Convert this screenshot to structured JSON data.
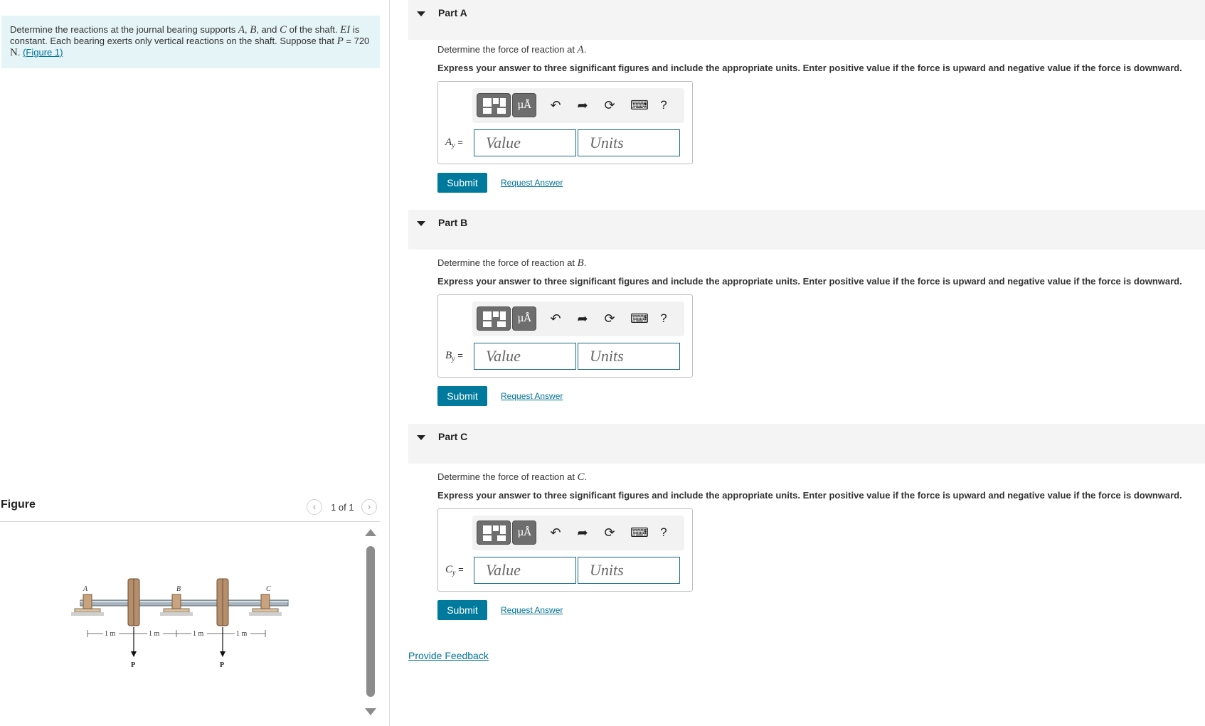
{
  "problem": {
    "text_1": "Determine the reactions at the journal bearing supports ",
    "var_a": "A",
    "text_2": ", ",
    "var_b": "B",
    "text_3": ", and ",
    "var_c": "C",
    "text_4": " of the shaft. ",
    "var_ei": "EI",
    "text_5": " is constant. Each bearing exerts only vertical reactions on the shaft. Suppose that ",
    "var_p": "P",
    "text_6": " = 720 ",
    "unit_n": "N",
    "text_7": ". ",
    "figure_link": "(Figure 1)"
  },
  "figure": {
    "title": "Figure",
    "counter": "1 of 1",
    "prev_icon": "chevron-left-icon",
    "next_icon": "chevron-right-icon",
    "labels": {
      "a": "A",
      "b": "B",
      "c": "C",
      "dim1": "1 m",
      "dim2": "1 m",
      "dim3": "1 m",
      "dim4": "1 m",
      "p1": "P",
      "p2": "P"
    }
  },
  "parts": [
    {
      "title": "Part A",
      "q1_text": "Determine the force of reaction at ",
      "q1_var": "A",
      "q1_end": ".",
      "q2": "Express your answer to three significant figures and include the appropriate units. Enter positive value if the force is upward and negative value if the force is downward.",
      "var_base": "A",
      "var_sub": "y",
      "equals": " =",
      "value_placeholder": "Value",
      "units_placeholder": "Units",
      "submit": "Submit",
      "request": "Request Answer"
    },
    {
      "title": "Part B",
      "q1_text": "Determine the force of reaction at ",
      "q1_var": "B",
      "q1_end": ".",
      "q2": "Express your answer to three significant figures and include the appropriate units. Enter positive value if the force is upward and negative value if the force is downward.",
      "var_base": "B",
      "var_sub": "y",
      "equals": " =",
      "value_placeholder": "Value",
      "units_placeholder": "Units",
      "submit": "Submit",
      "request": "Request Answer"
    },
    {
      "title": "Part C",
      "q1_text": "Determine the force of reaction at ",
      "q1_var": "C",
      "q1_end": ".",
      "q2": "Express your answer to three significant figures and include the appropriate units. Enter positive value if the force is upward and negative value if the force is downward.",
      "var_base": "C",
      "var_sub": "y",
      "equals": " =",
      "value_placeholder": "Value",
      "units_placeholder": "Units",
      "submit": "Submit",
      "request": "Request Answer"
    }
  ],
  "toolbar": {
    "units_label": "μÅ",
    "help": "?",
    "icons": [
      "templates-icon",
      "units-icon",
      "undo-icon",
      "redo-icon",
      "reset-icon",
      "keyboard-icon",
      "help-icon"
    ]
  },
  "feedback": "Provide Feedback",
  "colors": {
    "accent": "#007a9c",
    "link": "#007398",
    "problem_bg": "#e5f4f6",
    "part_header_bg": "#f4f4f4"
  }
}
